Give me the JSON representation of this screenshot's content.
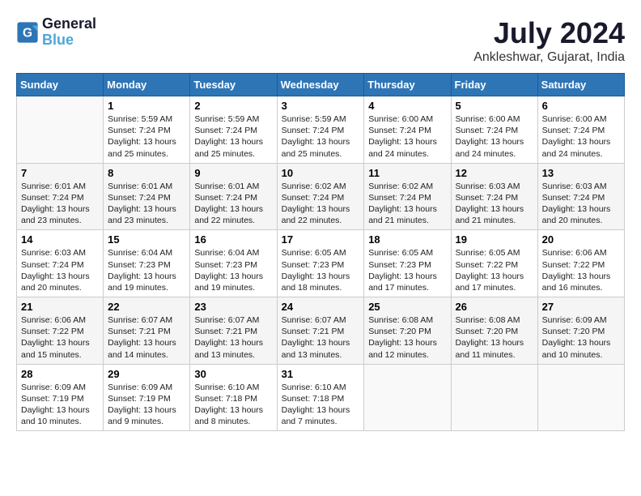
{
  "logo": {
    "text_general": "General",
    "text_blue": "Blue"
  },
  "header": {
    "title": "July 2024",
    "subtitle": "Ankleshwar, Gujarat, India"
  },
  "weekdays": [
    "Sunday",
    "Monday",
    "Tuesday",
    "Wednesday",
    "Thursday",
    "Friday",
    "Saturday"
  ],
  "weeks": [
    [
      {
        "day": "",
        "info": ""
      },
      {
        "day": "1",
        "info": "Sunrise: 5:59 AM\nSunset: 7:24 PM\nDaylight: 13 hours\nand 25 minutes."
      },
      {
        "day": "2",
        "info": "Sunrise: 5:59 AM\nSunset: 7:24 PM\nDaylight: 13 hours\nand 25 minutes."
      },
      {
        "day": "3",
        "info": "Sunrise: 5:59 AM\nSunset: 7:24 PM\nDaylight: 13 hours\nand 25 minutes."
      },
      {
        "day": "4",
        "info": "Sunrise: 6:00 AM\nSunset: 7:24 PM\nDaylight: 13 hours\nand 24 minutes."
      },
      {
        "day": "5",
        "info": "Sunrise: 6:00 AM\nSunset: 7:24 PM\nDaylight: 13 hours\nand 24 minutes."
      },
      {
        "day": "6",
        "info": "Sunrise: 6:00 AM\nSunset: 7:24 PM\nDaylight: 13 hours\nand 24 minutes."
      }
    ],
    [
      {
        "day": "7",
        "info": "Sunrise: 6:01 AM\nSunset: 7:24 PM\nDaylight: 13 hours\nand 23 minutes."
      },
      {
        "day": "8",
        "info": "Sunrise: 6:01 AM\nSunset: 7:24 PM\nDaylight: 13 hours\nand 23 minutes."
      },
      {
        "day": "9",
        "info": "Sunrise: 6:01 AM\nSunset: 7:24 PM\nDaylight: 13 hours\nand 22 minutes."
      },
      {
        "day": "10",
        "info": "Sunrise: 6:02 AM\nSunset: 7:24 PM\nDaylight: 13 hours\nand 22 minutes."
      },
      {
        "day": "11",
        "info": "Sunrise: 6:02 AM\nSunset: 7:24 PM\nDaylight: 13 hours\nand 21 minutes."
      },
      {
        "day": "12",
        "info": "Sunrise: 6:03 AM\nSunset: 7:24 PM\nDaylight: 13 hours\nand 21 minutes."
      },
      {
        "day": "13",
        "info": "Sunrise: 6:03 AM\nSunset: 7:24 PM\nDaylight: 13 hours\nand 20 minutes."
      }
    ],
    [
      {
        "day": "14",
        "info": "Sunrise: 6:03 AM\nSunset: 7:24 PM\nDaylight: 13 hours\nand 20 minutes."
      },
      {
        "day": "15",
        "info": "Sunrise: 6:04 AM\nSunset: 7:23 PM\nDaylight: 13 hours\nand 19 minutes."
      },
      {
        "day": "16",
        "info": "Sunrise: 6:04 AM\nSunset: 7:23 PM\nDaylight: 13 hours\nand 19 minutes."
      },
      {
        "day": "17",
        "info": "Sunrise: 6:05 AM\nSunset: 7:23 PM\nDaylight: 13 hours\nand 18 minutes."
      },
      {
        "day": "18",
        "info": "Sunrise: 6:05 AM\nSunset: 7:23 PM\nDaylight: 13 hours\nand 17 minutes."
      },
      {
        "day": "19",
        "info": "Sunrise: 6:05 AM\nSunset: 7:22 PM\nDaylight: 13 hours\nand 17 minutes."
      },
      {
        "day": "20",
        "info": "Sunrise: 6:06 AM\nSunset: 7:22 PM\nDaylight: 13 hours\nand 16 minutes."
      }
    ],
    [
      {
        "day": "21",
        "info": "Sunrise: 6:06 AM\nSunset: 7:22 PM\nDaylight: 13 hours\nand 15 minutes."
      },
      {
        "day": "22",
        "info": "Sunrise: 6:07 AM\nSunset: 7:21 PM\nDaylight: 13 hours\nand 14 minutes."
      },
      {
        "day": "23",
        "info": "Sunrise: 6:07 AM\nSunset: 7:21 PM\nDaylight: 13 hours\nand 13 minutes."
      },
      {
        "day": "24",
        "info": "Sunrise: 6:07 AM\nSunset: 7:21 PM\nDaylight: 13 hours\nand 13 minutes."
      },
      {
        "day": "25",
        "info": "Sunrise: 6:08 AM\nSunset: 7:20 PM\nDaylight: 13 hours\nand 12 minutes."
      },
      {
        "day": "26",
        "info": "Sunrise: 6:08 AM\nSunset: 7:20 PM\nDaylight: 13 hours\nand 11 minutes."
      },
      {
        "day": "27",
        "info": "Sunrise: 6:09 AM\nSunset: 7:20 PM\nDaylight: 13 hours\nand 10 minutes."
      }
    ],
    [
      {
        "day": "28",
        "info": "Sunrise: 6:09 AM\nSunset: 7:19 PM\nDaylight: 13 hours\nand 10 minutes."
      },
      {
        "day": "29",
        "info": "Sunrise: 6:09 AM\nSunset: 7:19 PM\nDaylight: 13 hours\nand 9 minutes."
      },
      {
        "day": "30",
        "info": "Sunrise: 6:10 AM\nSunset: 7:18 PM\nDaylight: 13 hours\nand 8 minutes."
      },
      {
        "day": "31",
        "info": "Sunrise: 6:10 AM\nSunset: 7:18 PM\nDaylight: 13 hours\nand 7 minutes."
      },
      {
        "day": "",
        "info": ""
      },
      {
        "day": "",
        "info": ""
      },
      {
        "day": "",
        "info": ""
      }
    ]
  ]
}
